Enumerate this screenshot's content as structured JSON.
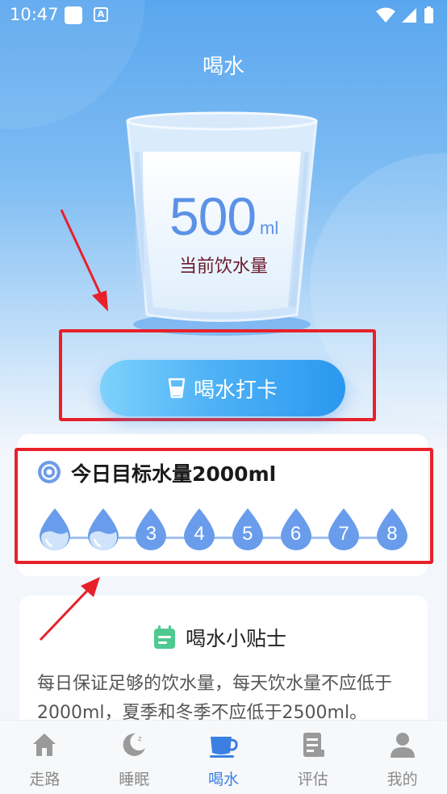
{
  "status_bar": {
    "time": "10:47",
    "notification_letter": "A"
  },
  "page": {
    "title": "喝水"
  },
  "glass": {
    "value": "500",
    "unit": "ml",
    "label": "当前饮水量"
  },
  "checkin": {
    "label": "喝水打卡"
  },
  "goal": {
    "title": "今日目标水量2000ml",
    "drops": [
      {
        "label": "",
        "filled": true
      },
      {
        "label": "",
        "filled": true
      },
      {
        "label": "3",
        "filled": false
      },
      {
        "label": "4",
        "filled": false
      },
      {
        "label": "5",
        "filled": false
      },
      {
        "label": "6",
        "filled": false
      },
      {
        "label": "7",
        "filled": false
      },
      {
        "label": "8",
        "filled": false
      }
    ]
  },
  "tips": {
    "title": "喝水小贴士",
    "text": "每日保证足够的饮水量，每天饮水量不应低于2000ml，夏季和冬季不应低于2500ml。"
  },
  "tabs": [
    {
      "label": "走路",
      "icon": "home-icon",
      "active": false
    },
    {
      "label": "睡眠",
      "icon": "moon-icon",
      "active": false
    },
    {
      "label": "喝水",
      "icon": "cup-icon",
      "active": true
    },
    {
      "label": "评估",
      "icon": "document-icon",
      "active": false
    },
    {
      "label": "我的",
      "icon": "user-icon",
      "active": false
    }
  ],
  "colors": {
    "accent": "#3b7fe3",
    "highlight_box": "#e8202a",
    "water_value": "#5b92e6",
    "drop_fill": "#6a9cec"
  }
}
